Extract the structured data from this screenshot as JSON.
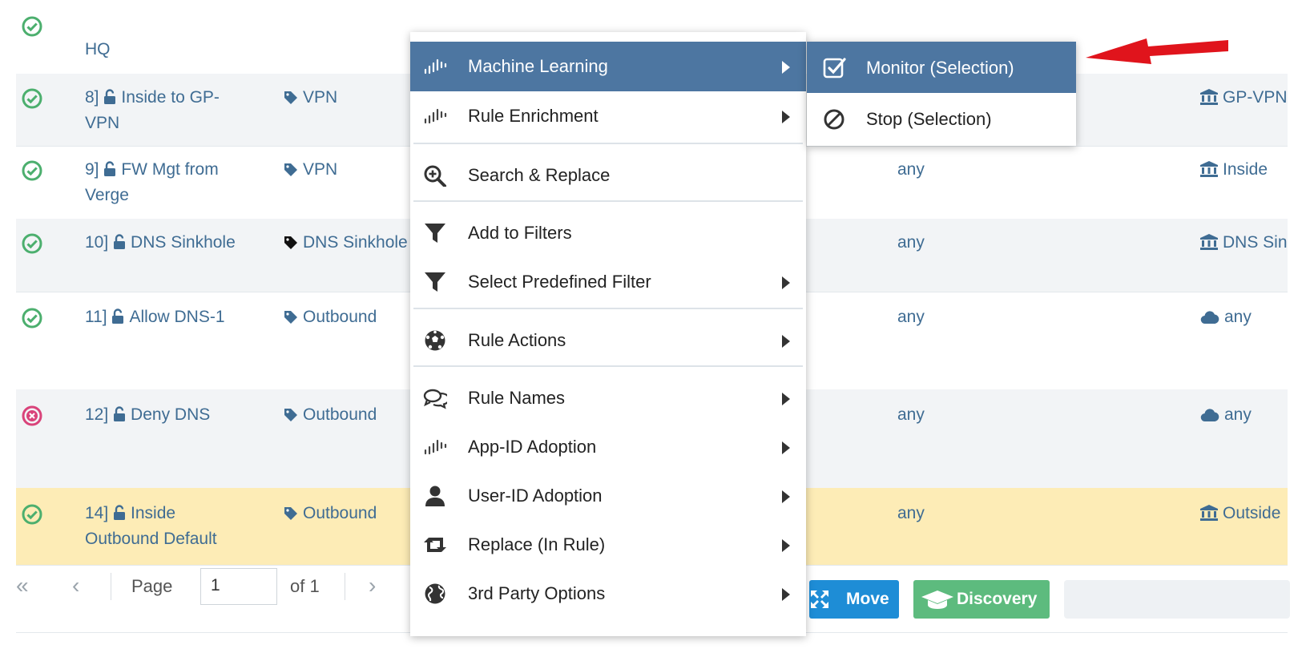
{
  "rows": [
    {
      "status": "ok",
      "name_line1": "HQ",
      "name_line2": "",
      "tag": "",
      "any": "",
      "zone": ""
    },
    {
      "status": "ok",
      "number": "8]",
      "name_line1": "Inside to GP-",
      "name_line2": "VPN",
      "tag": "VPN",
      "any": "",
      "zone": "GP-VPN"
    },
    {
      "status": "ok",
      "number": "9]",
      "name_line1": "FW Mgt from",
      "name_line2": "Verge",
      "tag": "VPN",
      "any": "any",
      "zone": "Inside"
    },
    {
      "status": "ok",
      "number": "10]",
      "name_line1": "DNS Sinkhole",
      "name_line2": "",
      "tag": "DNS Sinkhole",
      "any": "any",
      "zone": "DNS Sin"
    },
    {
      "status": "ok",
      "number": "11]",
      "name_line1": "Allow DNS-1",
      "name_line2": "",
      "tag": "Outbound",
      "any": "any",
      "zone": "any"
    },
    {
      "status": "deny",
      "number": "12]",
      "name_line1": "Deny DNS",
      "name_line2": "",
      "tag": "Outbound",
      "any": "any",
      "zone": "any"
    },
    {
      "status": "ok",
      "number": "14]",
      "name_line1": "Inside",
      "name_line2": "Outbound Default",
      "tag": "Outbound",
      "any": "any",
      "zone": "Outside"
    }
  ],
  "pager": {
    "page_label": "Page",
    "page_value": "1",
    "of_label": "of 1"
  },
  "buttons": {
    "move": "Move",
    "discovery": "Discovery"
  },
  "context_menu": {
    "items": [
      {
        "label": "Machine Learning",
        "icon": "ml-wave-icon",
        "submenu": true,
        "active": true
      },
      {
        "label": "Rule Enrichment",
        "icon": "ml-wave-icon",
        "submenu": true
      },
      {
        "label": "Search & Replace",
        "icon": "search-plus-icon",
        "submenu": false
      },
      {
        "label": "Add to Filters",
        "icon": "filter-icon",
        "submenu": false
      },
      {
        "label": "Select Predefined Filter",
        "icon": "filter-icon",
        "submenu": true
      },
      {
        "label": "Rule Actions",
        "icon": "soccer-ball-icon",
        "submenu": true
      },
      {
        "label": "Rule Names",
        "icon": "chat-bubbles-icon",
        "submenu": true
      },
      {
        "label": "App-ID Adoption",
        "icon": "ml-wave-icon",
        "submenu": true
      },
      {
        "label": "User-ID Adoption",
        "icon": "user-icon",
        "submenu": true
      },
      {
        "label": "Replace (In Rule)",
        "icon": "retweet-icon",
        "submenu": true
      },
      {
        "label": "3rd Party Options",
        "icon": "globe-icon",
        "submenu": true
      }
    ]
  },
  "submenu": {
    "items": [
      {
        "label": "Monitor (Selection)",
        "icon": "checkbox-icon",
        "active": true
      },
      {
        "label": "Stop (Selection)",
        "icon": "ban-icon"
      }
    ]
  },
  "colors": {
    "menu_active": "#4d76a1",
    "row_highlight": "#fdecb6",
    "ok_green": "#4caf6e",
    "deny_red": "#d9437a",
    "arrow_red": "#e0141c",
    "move_blue": "#1e8dd6",
    "discovery_green": "#5dbb7e"
  }
}
